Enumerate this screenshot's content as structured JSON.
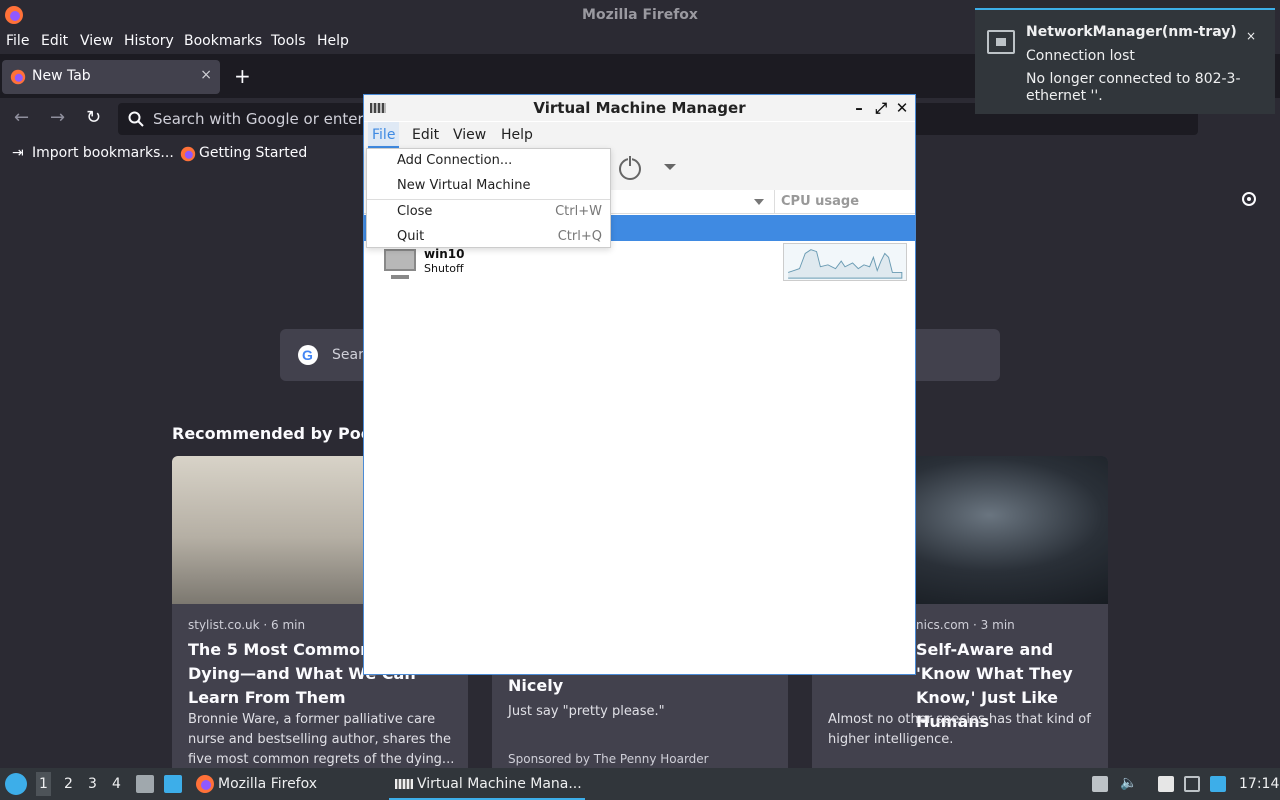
{
  "firefox": {
    "window_title": "Mozilla Firefox",
    "menu": [
      "File",
      "Edit",
      "View",
      "History",
      "Bookmarks",
      "Tools",
      "Help"
    ],
    "tab_title": "New Tab",
    "tab_close": "×",
    "new_tab": "+",
    "url_placeholder": "Search with Google or enter a",
    "bookmarks": [
      "Import bookmarks...",
      "Getting Started"
    ],
    "search_placeholder": "Sear",
    "pocket_heading": "Recommended by Pocke",
    "cards": [
      {
        "source": "stylist.co.uk · 6 min",
        "title": "The 5 Most Common R the Dying—and What We Can Learn From Them",
        "excerpt": "Bronnie Ware, a former palliative care nurse and bestselling author, shares the five most common regrets of the dying..."
      },
      {
        "source": "",
        "title": "Money When They're Asked Nicely",
        "excerpt": "Just say \"pretty please.\"",
        "sponsor": "Sponsored by The Penny Hoarder"
      },
      {
        "source": "nics.com · 3 min",
        "title": "Self-Aware and 'Know What They Know,' Just Like Humans",
        "excerpt": "Almost no other species has that kind of higher intelligence."
      }
    ]
  },
  "notification": {
    "title": "NetworkManager(nm-tray)",
    "line1": "Connection lost",
    "line2": "No longer connected to 802-3-ethernet ''.",
    "close": "×"
  },
  "vmm": {
    "title": "Virtual Machine Manager",
    "menu": [
      "File",
      "Edit",
      "View",
      "Help"
    ],
    "column_cpu": "CPU usage",
    "file_menu": [
      {
        "label": "Add Connection...",
        "shortcut": ""
      },
      {
        "label": "New Virtual Machine",
        "shortcut": ""
      },
      {
        "label": "Close",
        "shortcut": "Ctrl+W"
      },
      {
        "label": "Quit",
        "shortcut": "Ctrl+Q"
      }
    ],
    "vm": {
      "name": "win10",
      "state": "Shutoff"
    },
    "controls": {
      "min": "–",
      "max": "⤢",
      "close": "✕"
    }
  },
  "taskbar": {
    "workspaces": [
      "1",
      "2",
      "3",
      "4"
    ],
    "tasks": [
      "Mozilla Firefox",
      "Virtual Machine Mana..."
    ],
    "clock": "17:14"
  },
  "colors": {
    "accent": "#3f8ae2",
    "taskbar_bg": "#31363b",
    "firefox_bg": "#2b2a33"
  }
}
